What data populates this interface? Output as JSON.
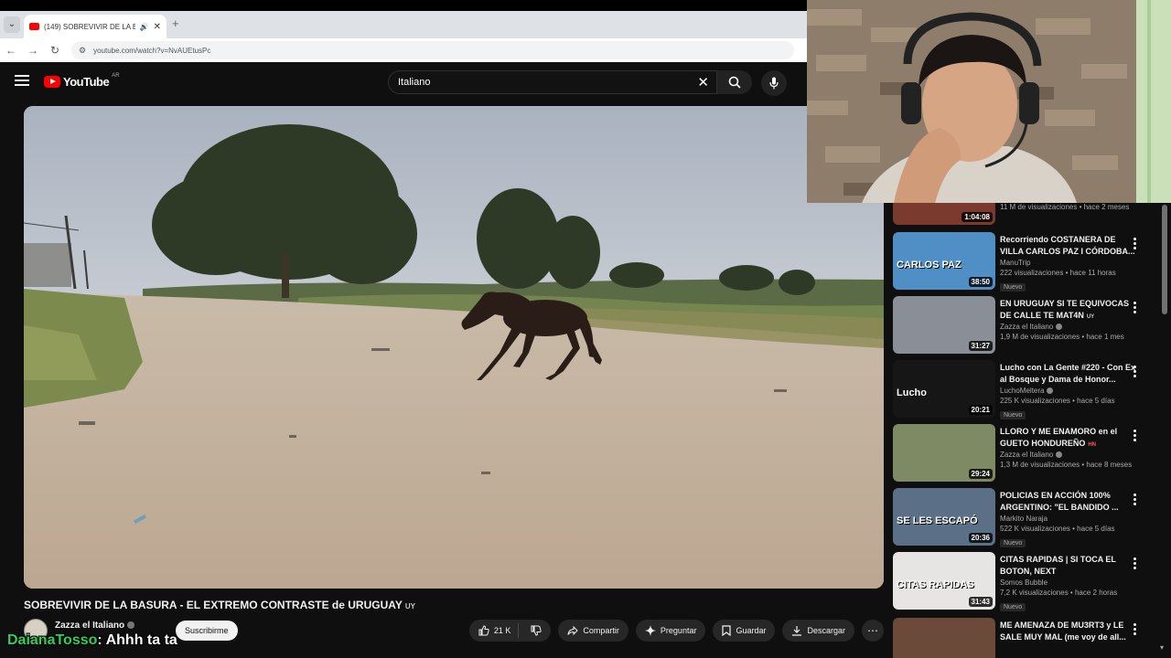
{
  "browser": {
    "tab_title": "(149) SOBREVIVIR DE LA BA",
    "url": "youtube.com/watch?v=NvAUEtusPc"
  },
  "youtube": {
    "logo_text": "YouTube",
    "logo_country": "AR",
    "search_query": "Italiano"
  },
  "video": {
    "title": "SOBREVIVIR DE LA BASURA - EL EXTREMO CONTRASTE de URUGUAY",
    "title_flag": "UY",
    "channel": "Zazza el Italiano",
    "subscribe_label": "Suscribirme",
    "likes": "21 K",
    "share_label": "Compartir",
    "ask_label": "Preguntar",
    "save_label": "Guardar",
    "download_label": "Descargar"
  },
  "chat": {
    "user": "DaianaTosso",
    "message": ": Ahhh ta ta"
  },
  "sidebar": {
    "partial_top": {
      "duration": "1:04:08",
      "meta": "11 M de visualizaciones • hace 2 meses"
    },
    "items": [
      {
        "title": "Recorriendo COSTANERA DE VILLA CARLOS PAZ I CÓRDOBA...",
        "channel": "ManuTrip",
        "verified": false,
        "views": "222 visualizaciones • hace 11 horas",
        "badge": "Nuevo",
        "duration": "38:50",
        "thumb_caption": "CARLOS PAZ",
        "thumb_color": "#4f8fc6"
      },
      {
        "title": "EN URUGUAY SI TE EQUIVOCAS DE CALLE TE MAT4N",
        "title_flag": "UY",
        "channel": "Zazza el Italiano",
        "verified": true,
        "views": "1,9 M de visualizaciones • hace 1 mes",
        "badge": "",
        "duration": "31:27",
        "thumb_caption": "",
        "thumb_color": "#8a8f97"
      },
      {
        "title": "Lucho con La Gente #220 - Con Ex al Bosque y Dama de Honor...",
        "channel": "LuchoMeltera",
        "verified": true,
        "views": "225 K visualizaciones • hace 5 días",
        "badge": "Nuevo",
        "duration": "20:21",
        "thumb_caption": "Lucho",
        "thumb_color": "#161616"
      },
      {
        "title": "LLORO Y ME ENAMORO en el GUETO HONDUREÑO",
        "title_flag": "HN",
        "channel": "Zazza el Italiano",
        "verified": true,
        "views": "1,3 M de visualizaciones • hace 8 meses",
        "badge": "",
        "duration": "29:24",
        "thumb_caption": "",
        "thumb_color": "#7d8a63"
      },
      {
        "title": "POLICIAS EN ACCIÓN 100% ARGENTINO: \"EL BANDIDO ...",
        "channel": "Markito Naraja",
        "verified": false,
        "views": "522 K visualizaciones • hace 5 días",
        "badge": "Nuevo",
        "duration": "20:36",
        "thumb_caption": "SE LES ESCAPÓ",
        "thumb_color": "#5b6f86"
      },
      {
        "title": "CITAS RAPIDAS | SI TOCA EL BOTON, NEXT",
        "channel": "Somos Bubble",
        "verified": false,
        "views": "7,2 K visualizaciones • hace 2 horas",
        "badge": "Nuevo",
        "duration": "31:43",
        "thumb_caption": "CITAS RAPIDAS",
        "thumb_color": "#e7e4e4"
      },
      {
        "title": "ME AMENAZA DE MU3RT3 y LE SALE MUY MAL (me voy de all...",
        "channel": "",
        "verified": false,
        "views": "",
        "badge": "",
        "duration": "",
        "thumb_caption": "",
        "thumb_color": "#6b4a3a"
      }
    ]
  }
}
